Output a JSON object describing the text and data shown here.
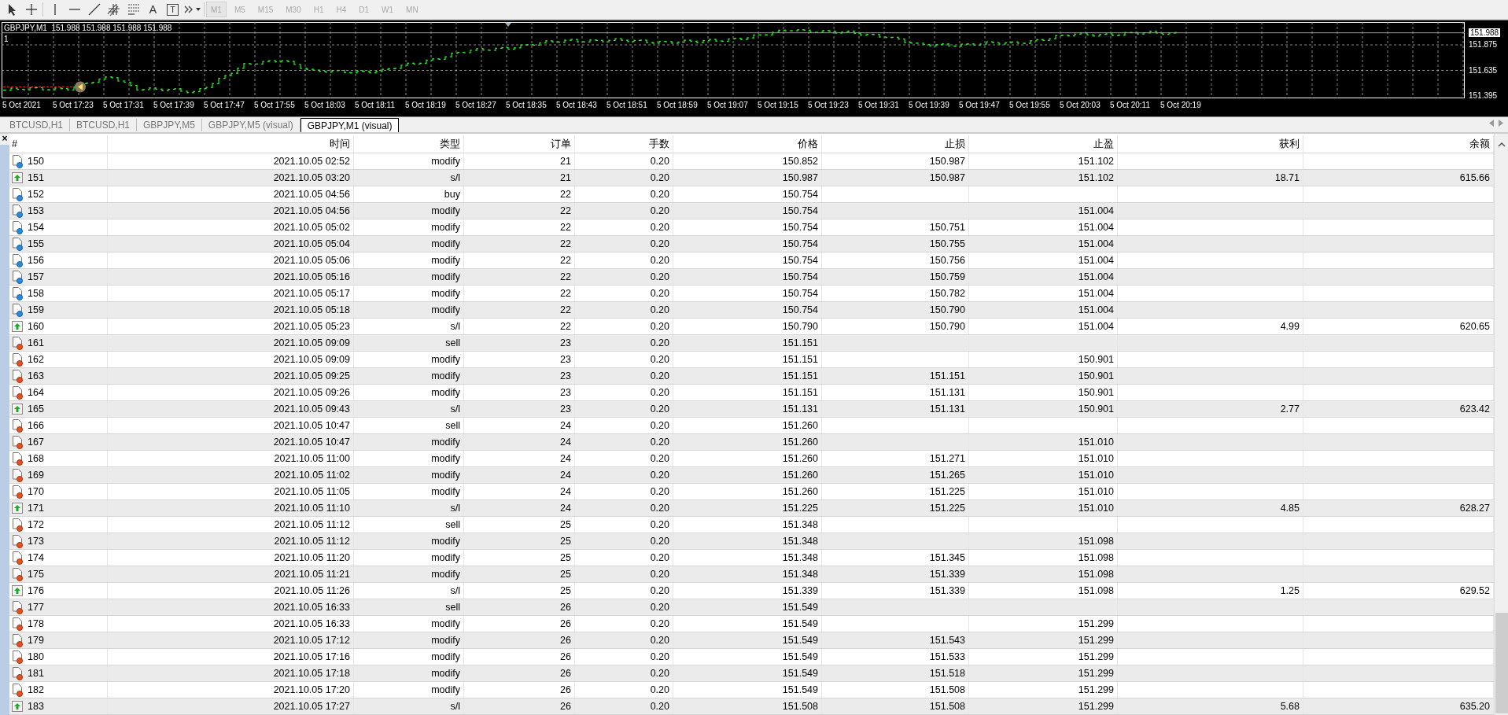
{
  "toolbar": {
    "glyphs": [
      "A",
      "T"
    ],
    "timeframes": [
      {
        "label": "M1",
        "selected": true
      },
      {
        "label": "M5",
        "selected": false
      },
      {
        "label": "M15",
        "selected": false
      },
      {
        "label": "M30",
        "selected": false
      },
      {
        "label": "H1",
        "selected": false
      },
      {
        "label": "H4",
        "selected": false
      },
      {
        "label": "D1",
        "selected": false
      },
      {
        "label": "W1",
        "selected": false
      },
      {
        "label": "MN",
        "selected": false
      }
    ]
  },
  "chart": {
    "header": "GBPJPY,M1  151.988 151.988 151.988 151.988",
    "window_index": "1",
    "current_price": "151.988",
    "price_labels": [
      "151.875",
      "151.635",
      "151.395"
    ],
    "time_labels": [
      "5 Oct 2021",
      "5 Oct 17:23",
      "5 Oct 17:31",
      "5 Oct 17:39",
      "5 Oct 17:47",
      "5 Oct 17:55",
      "5 Oct 18:03",
      "5 Oct 18:11",
      "5 Oct 18:19",
      "5 Oct 18:27",
      "5 Oct 18:35",
      "5 Oct 18:43",
      "5 Oct 18:51",
      "5 Oct 18:59",
      "5 Oct 19:07",
      "5 Oct 19:15",
      "5 Oct 19:23",
      "5 Oct 19:31",
      "5 Oct 19:39",
      "5 Oct 19:47",
      "5 Oct 19:55",
      "5 Oct 20:03",
      "5 Oct 20:11",
      "5 Oct 20:19"
    ]
  },
  "tabs": [
    {
      "label": "BTCUSD,H1",
      "selected": false
    },
    {
      "label": "BTCUSD,H1",
      "selected": false
    },
    {
      "label": "GBPJPY,M5",
      "selected": false
    },
    {
      "label": "GBPJPY,M5 (visual)",
      "selected": false
    },
    {
      "label": "GBPJPY,M1 (visual)",
      "selected": true
    }
  ],
  "close_mark": "×",
  "table": {
    "columns": [
      "#",
      "时间",
      "类型",
      "订单",
      "手数",
      "价格",
      "止损",
      "止盈",
      "获利",
      "余额"
    ],
    "rows": [
      {
        "kind": "long",
        "no": "150",
        "time": "2021.10.05 02:52",
        "type": "modify",
        "order": "21",
        "lots": "0.20",
        "price": "150.852",
        "sl": "150.987",
        "tp": "151.102"
      },
      {
        "kind": "closed",
        "no": "151",
        "time": "2021.10.05 03:20",
        "type": "s/l",
        "order": "21",
        "lots": "0.20",
        "price": "150.987",
        "sl": "150.987",
        "tp": "151.102",
        "profit": "18.71",
        "balance": "615.66"
      },
      {
        "kind": "long",
        "no": "152",
        "time": "2021.10.05 04:56",
        "type": "buy",
        "order": "22",
        "lots": "0.20",
        "price": "150.754"
      },
      {
        "kind": "long",
        "no": "153",
        "time": "2021.10.05 04:56",
        "type": "modify",
        "order": "22",
        "lots": "0.20",
        "price": "150.754",
        "tp": "151.004"
      },
      {
        "kind": "long",
        "no": "154",
        "time": "2021.10.05 05:02",
        "type": "modify",
        "order": "22",
        "lots": "0.20",
        "price": "150.754",
        "sl": "150.751",
        "tp": "151.004"
      },
      {
        "kind": "long",
        "no": "155",
        "time": "2021.10.05 05:04",
        "type": "modify",
        "order": "22",
        "lots": "0.20",
        "price": "150.754",
        "sl": "150.755",
        "tp": "151.004"
      },
      {
        "kind": "long",
        "no": "156",
        "time": "2021.10.05 05:06",
        "type": "modify",
        "order": "22",
        "lots": "0.20",
        "price": "150.754",
        "sl": "150.756",
        "tp": "151.004"
      },
      {
        "kind": "long",
        "no": "157",
        "time": "2021.10.05 05:16",
        "type": "modify",
        "order": "22",
        "lots": "0.20",
        "price": "150.754",
        "sl": "150.759",
        "tp": "151.004"
      },
      {
        "kind": "long",
        "no": "158",
        "time": "2021.10.05 05:17",
        "type": "modify",
        "order": "22",
        "lots": "0.20",
        "price": "150.754",
        "sl": "150.782",
        "tp": "151.004"
      },
      {
        "kind": "long",
        "no": "159",
        "time": "2021.10.05 05:18",
        "type": "modify",
        "order": "22",
        "lots": "0.20",
        "price": "150.754",
        "sl": "150.790",
        "tp": "151.004"
      },
      {
        "kind": "closed",
        "no": "160",
        "time": "2021.10.05 05:23",
        "type": "s/l",
        "order": "22",
        "lots": "0.20",
        "price": "150.790",
        "sl": "150.790",
        "tp": "151.004",
        "profit": "4.99",
        "balance": "620.65"
      },
      {
        "kind": "short",
        "no": "161",
        "time": "2021.10.05 09:09",
        "type": "sell",
        "order": "23",
        "lots": "0.20",
        "price": "151.151"
      },
      {
        "kind": "short",
        "no": "162",
        "time": "2021.10.05 09:09",
        "type": "modify",
        "order": "23",
        "lots": "0.20",
        "price": "151.151",
        "tp": "150.901"
      },
      {
        "kind": "short",
        "no": "163",
        "time": "2021.10.05 09:25",
        "type": "modify",
        "order": "23",
        "lots": "0.20",
        "price": "151.151",
        "sl": "151.151",
        "tp": "150.901"
      },
      {
        "kind": "short",
        "no": "164",
        "time": "2021.10.05 09:26",
        "type": "modify",
        "order": "23",
        "lots": "0.20",
        "price": "151.151",
        "sl": "151.131",
        "tp": "150.901"
      },
      {
        "kind": "closed",
        "no": "165",
        "time": "2021.10.05 09:43",
        "type": "s/l",
        "order": "23",
        "lots": "0.20",
        "price": "151.131",
        "sl": "151.131",
        "tp": "150.901",
        "profit": "2.77",
        "balance": "623.42"
      },
      {
        "kind": "short",
        "no": "166",
        "time": "2021.10.05 10:47",
        "type": "sell",
        "order": "24",
        "lots": "0.20",
        "price": "151.260"
      },
      {
        "kind": "short",
        "no": "167",
        "time": "2021.10.05 10:47",
        "type": "modify",
        "order": "24",
        "lots": "0.20",
        "price": "151.260",
        "tp": "151.010"
      },
      {
        "kind": "short",
        "no": "168",
        "time": "2021.10.05 11:00",
        "type": "modify",
        "order": "24",
        "lots": "0.20",
        "price": "151.260",
        "sl": "151.271",
        "tp": "151.010"
      },
      {
        "kind": "short",
        "no": "169",
        "time": "2021.10.05 11:02",
        "type": "modify",
        "order": "24",
        "lots": "0.20",
        "price": "151.260",
        "sl": "151.265",
        "tp": "151.010"
      },
      {
        "kind": "short",
        "no": "170",
        "time": "2021.10.05 11:05",
        "type": "modify",
        "order": "24",
        "lots": "0.20",
        "price": "151.260",
        "sl": "151.225",
        "tp": "151.010"
      },
      {
        "kind": "closed",
        "no": "171",
        "time": "2021.10.05 11:10",
        "type": "s/l",
        "order": "24",
        "lots": "0.20",
        "price": "151.225",
        "sl": "151.225",
        "tp": "151.010",
        "profit": "4.85",
        "balance": "628.27"
      },
      {
        "kind": "short",
        "no": "172",
        "time": "2021.10.05 11:12",
        "type": "sell",
        "order": "25",
        "lots": "0.20",
        "price": "151.348"
      },
      {
        "kind": "short",
        "no": "173",
        "time": "2021.10.05 11:12",
        "type": "modify",
        "order": "25",
        "lots": "0.20",
        "price": "151.348",
        "tp": "151.098"
      },
      {
        "kind": "short",
        "no": "174",
        "time": "2021.10.05 11:20",
        "type": "modify",
        "order": "25",
        "lots": "0.20",
        "price": "151.348",
        "sl": "151.345",
        "tp": "151.098"
      },
      {
        "kind": "short",
        "no": "175",
        "time": "2021.10.05 11:21",
        "type": "modify",
        "order": "25",
        "lots": "0.20",
        "price": "151.348",
        "sl": "151.339",
        "tp": "151.098"
      },
      {
        "kind": "closed",
        "no": "176",
        "time": "2021.10.05 11:26",
        "type": "s/l",
        "order": "25",
        "lots": "0.20",
        "price": "151.339",
        "sl": "151.339",
        "tp": "151.098",
        "profit": "1.25",
        "balance": "629.52"
      },
      {
        "kind": "short",
        "no": "177",
        "time": "2021.10.05 16:33",
        "type": "sell",
        "order": "26",
        "lots": "0.20",
        "price": "151.549"
      },
      {
        "kind": "short",
        "no": "178",
        "time": "2021.10.05 16:33",
        "type": "modify",
        "order": "26",
        "lots": "0.20",
        "price": "151.549",
        "tp": "151.299"
      },
      {
        "kind": "short",
        "no": "179",
        "time": "2021.10.05 17:12",
        "type": "modify",
        "order": "26",
        "lots": "0.20",
        "price": "151.549",
        "sl": "151.543",
        "tp": "151.299"
      },
      {
        "kind": "short",
        "no": "180",
        "time": "2021.10.05 17:16",
        "type": "modify",
        "order": "26",
        "lots": "0.20",
        "price": "151.549",
        "sl": "151.533",
        "tp": "151.299"
      },
      {
        "kind": "short",
        "no": "181",
        "time": "2021.10.05 17:18",
        "type": "modify",
        "order": "26",
        "lots": "0.20",
        "price": "151.549",
        "sl": "151.518",
        "tp": "151.299"
      },
      {
        "kind": "short",
        "no": "182",
        "time": "2021.10.05 17:20",
        "type": "modify",
        "order": "26",
        "lots": "0.20",
        "price": "151.549",
        "sl": "151.508",
        "tp": "151.299"
      },
      {
        "kind": "closed",
        "no": "183",
        "time": "2021.10.05 17:27",
        "type": "s/l",
        "order": "26",
        "lots": "0.20",
        "price": "151.508",
        "sl": "151.508",
        "tp": "151.299",
        "profit": "5.68",
        "balance": "635.20"
      }
    ]
  }
}
